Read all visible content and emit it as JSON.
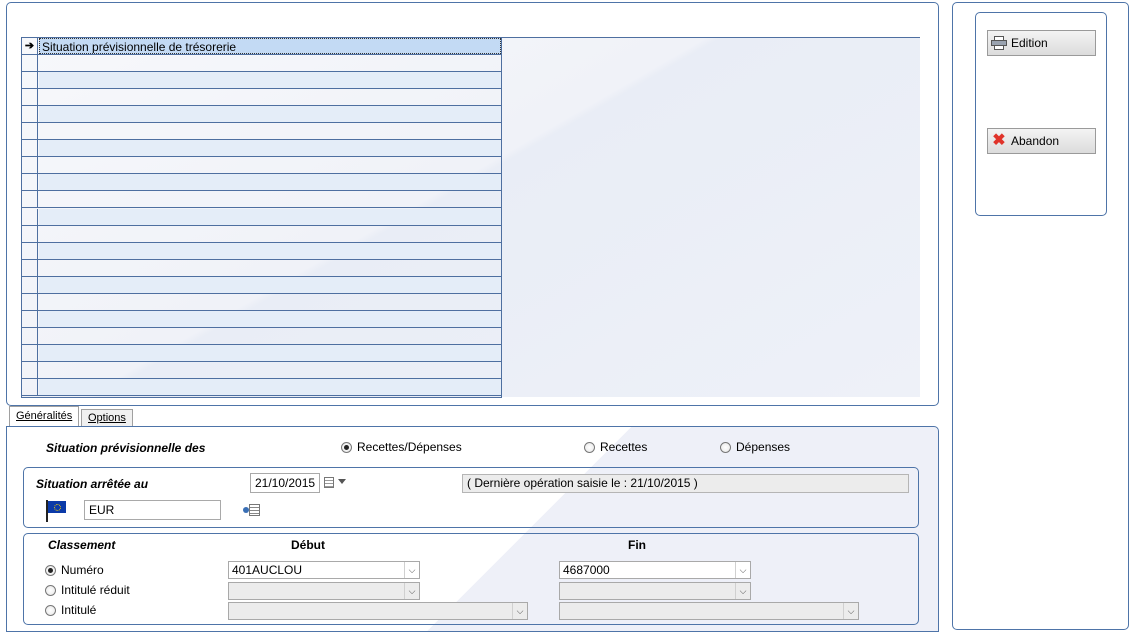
{
  "grid": {
    "header": "Situation prévisionnelle de trésorerie",
    "row_count": 21
  },
  "tabs": [
    {
      "label": "Généralités",
      "active": true
    },
    {
      "label": "Options",
      "active": false
    }
  ],
  "situation": {
    "label": "Situation prévisionnelle des",
    "options": [
      {
        "label": "Recettes/Dépenses",
        "selected": true
      },
      {
        "label": "Recettes",
        "selected": false
      },
      {
        "label": "Dépenses",
        "selected": false
      }
    ]
  },
  "arretee": {
    "label": "Situation arrêtée au",
    "date": "21/10/2015",
    "last_op": "( Dernière opération saisie le : 21/10/2015 )",
    "currency": "EUR"
  },
  "classement": {
    "label": "Classement",
    "debut_header": "Début",
    "fin_header": "Fin",
    "options": [
      {
        "label": "Numéro",
        "selected": true
      },
      {
        "label": "Intitulé réduit",
        "selected": false
      },
      {
        "label": "Intitulé",
        "selected": false
      }
    ],
    "debut_value": "401AUCLOU",
    "fin_value": "4687000"
  },
  "actions": {
    "edition": "Edition",
    "abandon": "Abandon"
  },
  "colors": {
    "border": "#4e74a8",
    "row_alt": "#e4edf8",
    "row_selected": "#c3daf4"
  }
}
